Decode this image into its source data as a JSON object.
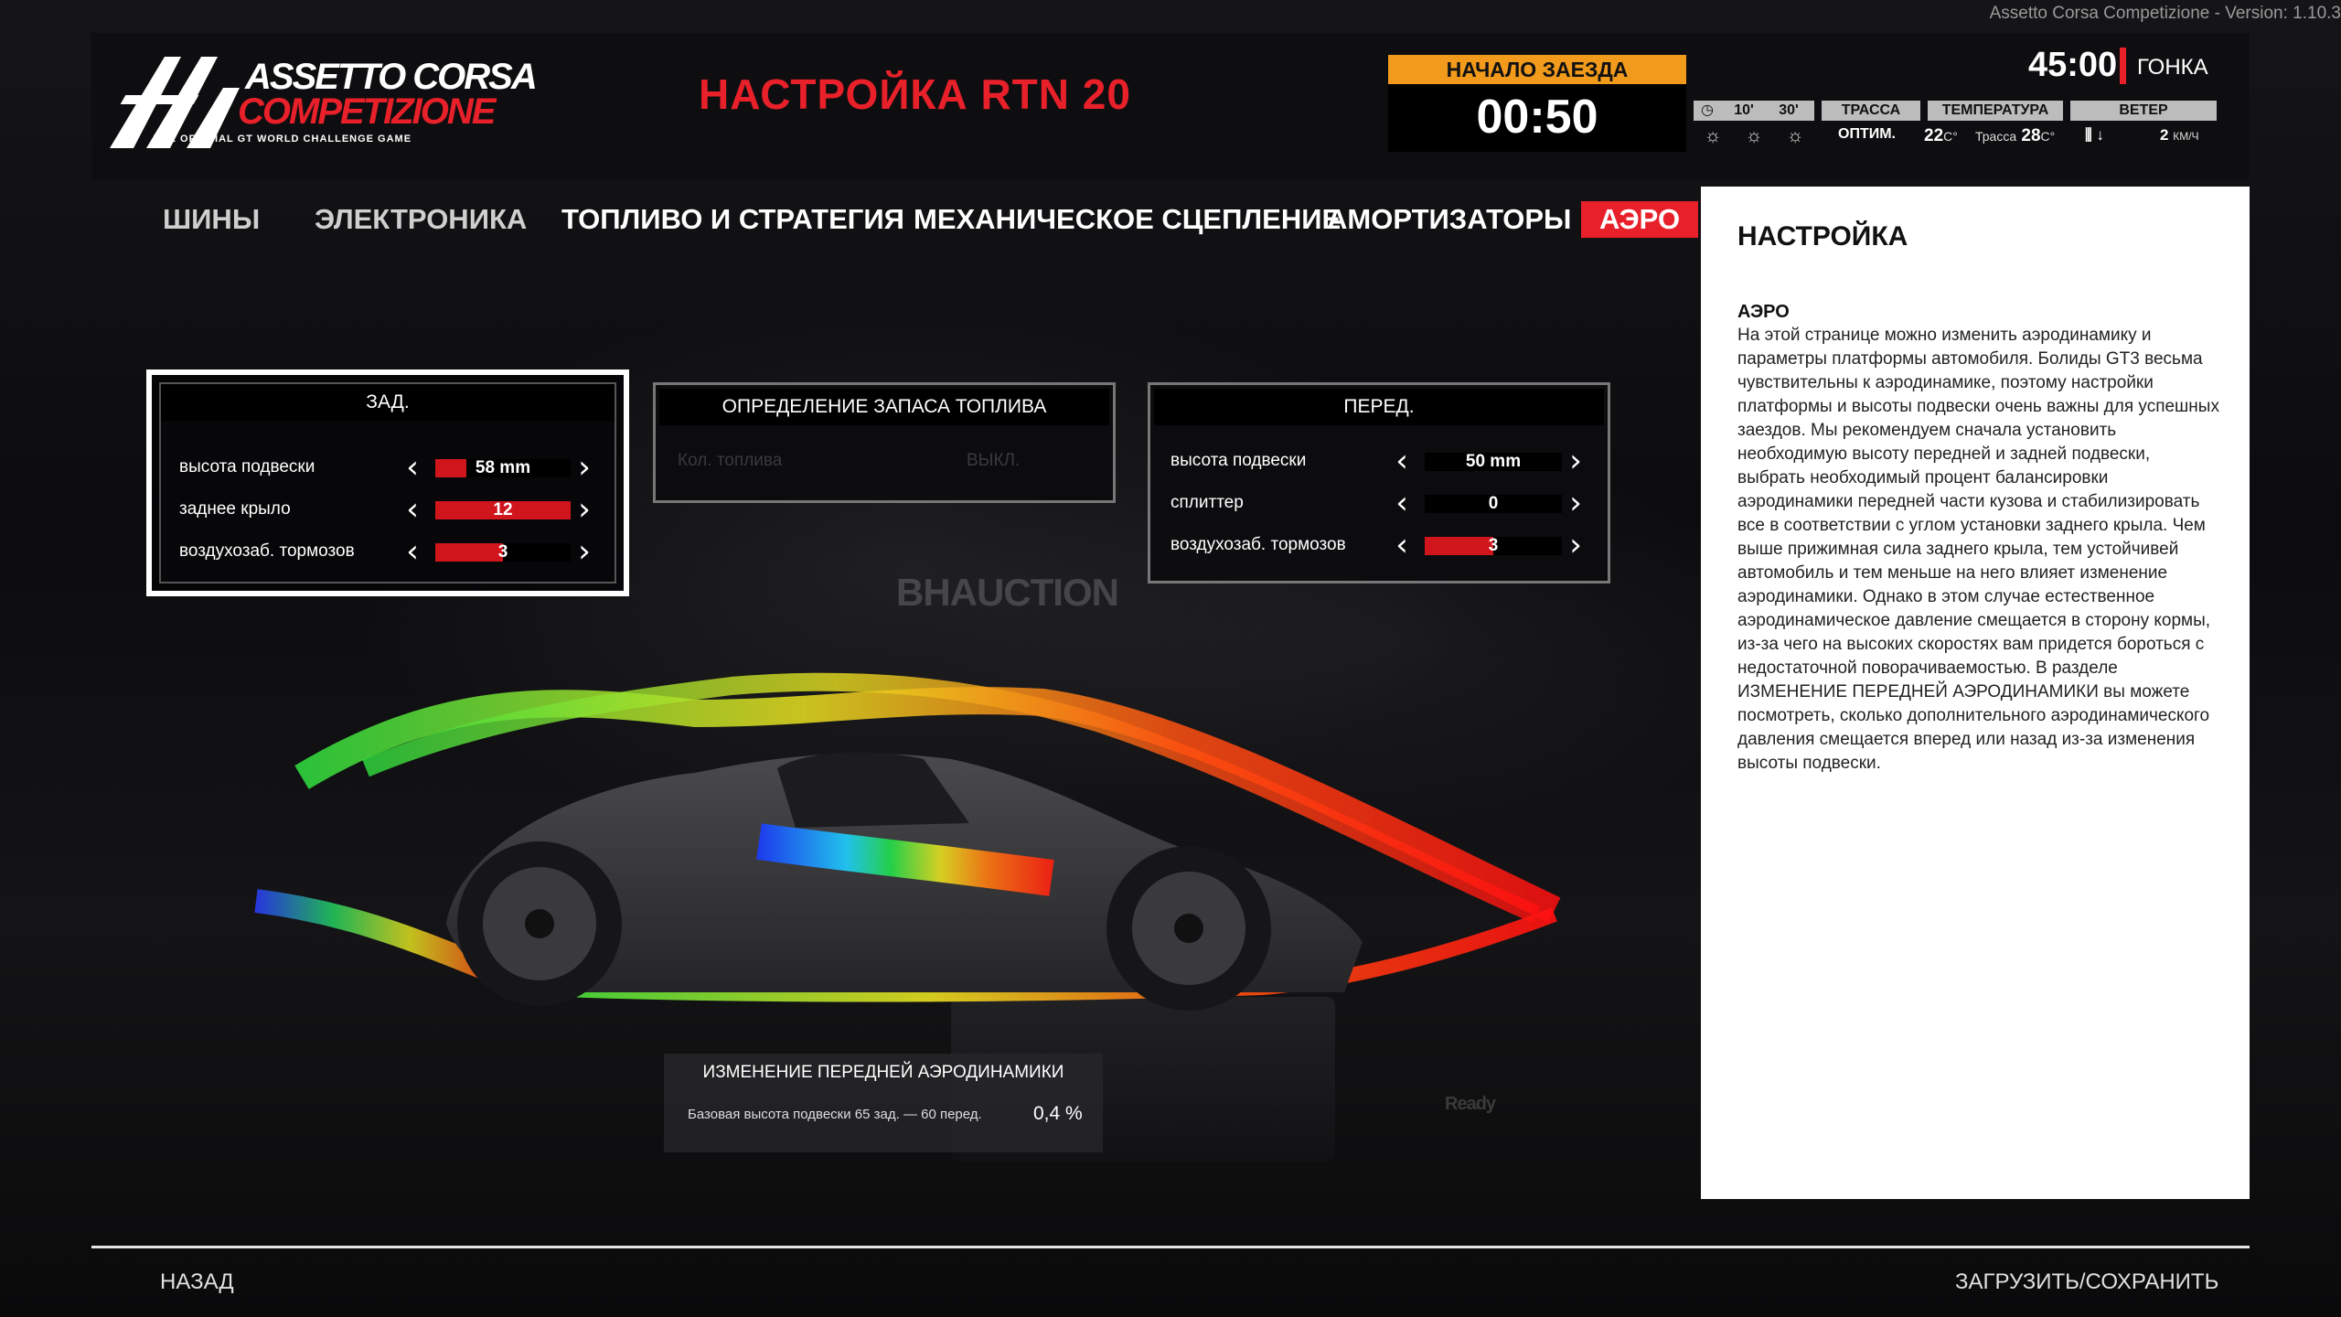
{
  "version": "Assetto Corsa Competizione - Version: 1.10.3",
  "logo": {
    "line1": "ASSETTO CORSA",
    "line2": "COMPETIZIONE",
    "tagline": "THE OFFICIAL GT WORLD CHALLENGE GAME"
  },
  "page_title": "НАСТРОЙКА RTN 20",
  "session": {
    "label": "НАЧАЛО ЗАЕЗДА",
    "time": "00:50"
  },
  "race": {
    "time": "45:00",
    "label": "ГОНКА"
  },
  "conditions": {
    "forecast_head": [
      "10'",
      "30'"
    ],
    "track_head": "ТРАССА",
    "track_value": "ОПТИМ.",
    "temp_head": "ТЕМПЕРАТУРА",
    "air_temp": "22",
    "temp_unit": "C°",
    "track_temp_label": "Трасса",
    "track_temp": "28",
    "wind_head": "ВЕТЕР",
    "wind_value": "2",
    "wind_unit": "КМ/Ч",
    "weather_icons": [
      "sun-icon",
      "sun-icon",
      "sun-icon"
    ]
  },
  "tabs": [
    {
      "label": "ШИНЫ",
      "active": false
    },
    {
      "label": "ЭЛЕКТРОНИКА",
      "active": false
    },
    {
      "label": "ТОПЛИВО И СТРАТЕГИЯ",
      "active": false
    },
    {
      "label": "МЕХАНИЧЕСКОЕ СЦЕПЛЕНИЕ",
      "active": false
    },
    {
      "label": "АМОРТИЗАТОРЫ",
      "active": false
    },
    {
      "label": "АЭРО",
      "active": true
    }
  ],
  "rear_panel": {
    "title": "ЗАД.",
    "rows": [
      {
        "label": "высота подвески",
        "value": "58 mm",
        "fill": 0.23
      },
      {
        "label": "заднее крыло",
        "value": "12",
        "fill": 1.0
      },
      {
        "label": "воздухозаб. тормозов",
        "value": "3",
        "fill": 0.5
      }
    ]
  },
  "fuel_panel": {
    "title": "ОПРЕДЕЛЕНИЕ ЗАПАСА ТОПЛИВА",
    "ghost_label": "Кол. топлива",
    "ghost_value": "ВЫКЛ."
  },
  "front_panel": {
    "title": "ПЕРЕД.",
    "rows": [
      {
        "label": "высота подвески",
        "value": "50 mm",
        "fill": 0.0
      },
      {
        "label": "сплиттер",
        "value": "0",
        "fill": 0.0
      },
      {
        "label": "воздухозаб. тормозов",
        "value": "3",
        "fill": 0.5
      }
    ]
  },
  "aero_change": {
    "title": "ИЗМЕНЕНИЕ ПЕРЕДНЕЙ АЭРОДИНАМИКИ",
    "description": "Базовая высота подвески 65 зад. — 60 перед.",
    "value": "0,4 %"
  },
  "info": {
    "title": "НАСТРОЙКА",
    "subtitle": "АЭРО",
    "text": "На этой странице можно изменить аэродинамику и параметры платформы автомобиля. Болиды GT3 весьма чувствительны к аэродинамике, поэтому настройки платформы и высоты подвески очень важны для успешных заездов. Мы рекомендуем сначала установить необходимую высоту передней и задней подвески, выбрать необходимый процент балансировки аэродинамики передней части кузова и стабилизировать все в соответствии с углом установки заднего крыла. Чем выше прижимная сила заднего крыла, тем устойчивей автомобиль и тем меньше на него влияет изменение аэродинамики. Однако в этом случае естественное аэродинамическое давление смещается в сторону кормы, из-за чего на высоких скоростях вам придется бороться с недостаточной поворачиваемостью. В разделе ИЗМЕНЕНИЕ ПЕРЕДНЕЙ АЭРОДИНАМИКИ вы можете посмотреть, сколько дополнительного аэродинамического давления смещается вперед или назад из-за изменения высоты подвески."
  },
  "background_signs": [
    "BHAUCTION",
    "Ready"
  ],
  "footer": {
    "back": "НАЗАД",
    "load_save": "ЗАГРУЗИТЬ/СОХРАНИТЬ"
  },
  "colors": {
    "accent_red": "#e8202a",
    "session_orange": "#f29a1c",
    "bar_red": "#d0151c"
  }
}
